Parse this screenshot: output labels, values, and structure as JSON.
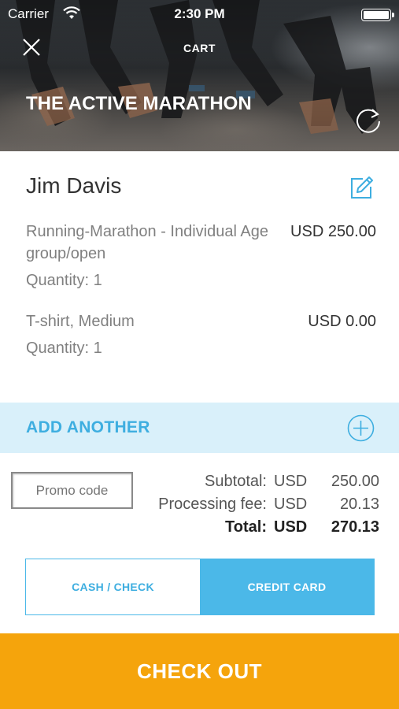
{
  "status_bar": {
    "carrier": "Carrier",
    "time": "2:30 PM"
  },
  "header": {
    "nav_title": "CART",
    "event_title": "THE ACTIVE MARATHON",
    "close_icon": "close-icon",
    "refresh_icon": "refresh-icon"
  },
  "cart": {
    "participant_name": "Jim Davis",
    "edit_icon": "edit-icon",
    "items": [
      {
        "description": "Running-Marathon - Individual Age group/open",
        "price": "USD 250.00",
        "quantity": "Quantity: 1"
      },
      {
        "description": "T-shirt, Medium",
        "price": "USD 0.00",
        "quantity": "Quantity: 1"
      }
    ]
  },
  "add_another": {
    "label": "ADD ANOTHER",
    "icon": "plus-circle-icon"
  },
  "promo": {
    "placeholder": "Promo code"
  },
  "totals": {
    "subtotal": {
      "label": "Subtotal:",
      "currency": "USD",
      "amount": "250.00"
    },
    "processing_fee": {
      "label": "Processing fee:",
      "currency": "USD",
      "amount": "20.13"
    },
    "total": {
      "label": "Total:",
      "currency": "USD",
      "amount": "270.13"
    }
  },
  "payment": {
    "options": [
      "CASH / CHECK",
      "CREDIT CARD"
    ],
    "selected": "CREDIT CARD"
  },
  "checkout": {
    "label": "CHECK OUT"
  },
  "colors": {
    "accent": "#4bb8e8",
    "accent_light": "#d9f0fa",
    "checkout": "#f5a40c"
  }
}
